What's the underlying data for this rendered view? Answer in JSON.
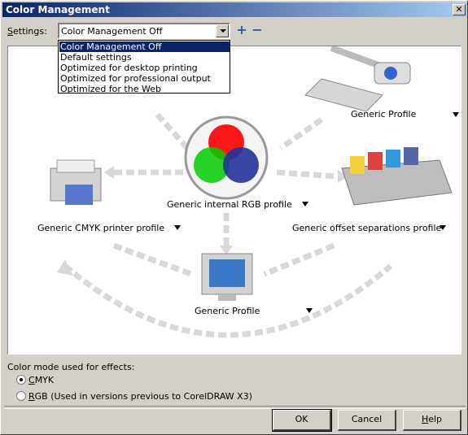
{
  "window": {
    "title": "Color Management",
    "close_symbol": "✕"
  },
  "settings": {
    "label": "Settings:",
    "selected": "Color Management Off",
    "add_symbol": "+",
    "remove_symbol": "−",
    "options": [
      "Color Management Off",
      "Default settings",
      "Optimized for desktop printing",
      "Optimized for professional output",
      "Optimized for the Web"
    ]
  },
  "devices": {
    "scanner": "Generic Profile",
    "internal_rgb": "Generic internal RGB profile",
    "cmyk_printer": "Generic CMYK printer profile",
    "offset_separations": "Generic offset separations profile",
    "monitor": "Generic Profile"
  },
  "effects": {
    "label": "Color mode used for effects:",
    "cmyk_accel": "C",
    "cmyk_rest": "MYK",
    "rgb_accel": "R",
    "rgb_rest": "GB (Used in versions previous to CorelDRAW X3)",
    "selected": "CMYK"
  },
  "buttons": {
    "ok": "OK",
    "cancel": "Cancel",
    "help_accel": "H",
    "help_rest": "elp"
  },
  "colors": {
    "title_start": "#0a246a",
    "title_end": "#a6caf0",
    "face": "#d4d0c8",
    "selection": "#0a246a"
  }
}
